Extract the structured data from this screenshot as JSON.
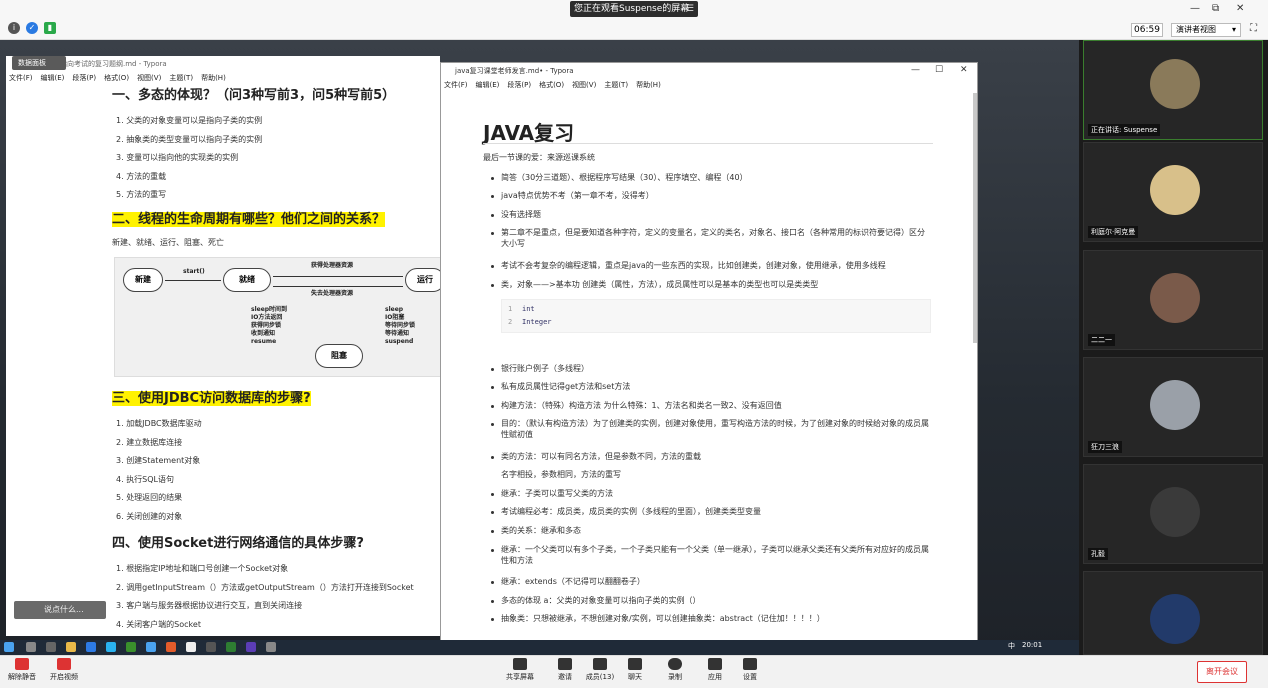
{
  "meeting": {
    "share_banner": "您正在观看Suspense的屏幕",
    "timer": "06:59",
    "view_mode": "演讲者视图"
  },
  "left_window": {
    "title": "指向考试的复习题纲.md - Typora",
    "vote_label": "数据面板",
    "menu": [
      "文件(F)",
      "编辑(E)",
      "段落(P)",
      "格式(O)",
      "视图(V)",
      "主题(T)",
      "帮助(H)"
    ],
    "h1": "一、多态的体现？（问3种写前3，问5种写前5）",
    "list1": [
      "父类的对象变量可以是指向子类的实例",
      "抽象类的类型变量可以指向子类的实例",
      "变量可以指向他的实现类的实例",
      "方法的重载",
      "方法的重写"
    ],
    "h2": "二、线程的生命周期有哪些？他们之间的关系？",
    "states": "新建、就绪、运行、阻塞、死亡",
    "diagram": {
      "new": "新建",
      "ready": "就绪",
      "run": "运行",
      "blocked": "阻塞",
      "start": "start()",
      "get_res": "获得处理器资源",
      "lose_res": "失去处理器资源",
      "left_notes": "sleep时间到\nIO方法返回\n获得同步锁\n收到通知\nresume",
      "right_notes": "sleep\nIO阻塞\n等待同步锁\n等待通知\nsuspend"
    },
    "h3": "三、使用JDBC访问数据库的步骤?",
    "list3": [
      "加载JDBC数据库驱动",
      "建立数据库连接",
      "创建Statement对象",
      "执行SQL语句",
      "处理返回的结果",
      "关闭创建的对象"
    ],
    "h4": "四、使用Socket进行网络通信的具体步骤?",
    "list4": [
      "根据指定IP地址和端口号创建一个Socket对象",
      "调用getInputStream（）方法或getOutputStream（）方法打开连接到Socket",
      "客户端与服务器根据协议进行交互，直到关闭连接",
      "关闭客户端的Socket"
    ],
    "chat_placeholder": "说点什么..."
  },
  "right_window": {
    "title": "java复习课堂老师发言.md• - Typora",
    "menu": [
      "文件(F)",
      "编辑(E)",
      "段落(P)",
      "格式(O)",
      "视图(V)",
      "主题(T)",
      "帮助(H)"
    ],
    "doc_title": "JAVA复习",
    "subtitle": "最后一节课的爱：来源巡课系统",
    "items1": [
      "简答（30分三道题）、根据程序写结果（30）、程序填空、编程（40）",
      "java特点优势不考（第一章不考，没得考）",
      "没有选择题",
      "第二章不是重点，但是要知道各种字符，定义的变量名，定义的类名，对象名、接口名（各种常用的标识符要记得）区分大小写",
      "考试不会考复杂的编程逻辑，重点是java的一些东西的实现，比如创建类，创建对象，使用继承，使用多线程",
      "类，对象——>基本功   创建类（属性，方法），成员属性可以是基本的类型也可以是类类型"
    ],
    "code": [
      "int",
      "Integer"
    ],
    "items2": [
      "银行账户例子（多线程）",
      "私有成员属性记得get方法和set方法",
      "构建方法：（特殊）构造方法 为什么特殊：1、方法名和类名一致2、没有返回值",
      "目的：（默认有构造方法）为了创建类的实例，创建对象使用，重写构造方法的时候，为了创建对象的时候给对象的成员属性赋初值",
      "类的方法：可以有同名方法，但是参数不同，方法的重载",
      "名字相投，参数相同，方法的重写",
      "继承：子类可以重写父类的方法",
      "考试编程必考：成员类，成员类的实例（多线程的里面），创建类类型变量",
      "类的关系：继承和多态",
      "继承：一个父类可以有多个子类，一个子类只能有一个父类（单一继承），子类可以继承父类还有父类所有对应好的成员属性和方法",
      "继承：extends（不记得可以翻翻卷子）",
      "多态的体现  a：父类的对象变量可以指向子类的实例（）",
      "抽象类：只想被继承，不想创建对象/实例，可以创建抽象类：abstract（记住加！！！！）"
    ]
  },
  "participants": [
    {
      "name": "正在讲话: Suspense"
    },
    {
      "name": "利庭尔·阿克曼"
    },
    {
      "name": "二二一"
    },
    {
      "name": "狂刀三浪"
    },
    {
      "name": "孔毅"
    },
    {
      "name": ""
    }
  ],
  "taskbar": {
    "lang": "中",
    "time": "20:01"
  },
  "toolbar": {
    "mute": "解除静音",
    "video": "开启视频",
    "share": "共享屏幕",
    "invite": "邀请",
    "members": "成员(13)",
    "chat": "聊天",
    "record": "录制",
    "apps": "应用",
    "settings": "设置",
    "leave": "离开会议"
  }
}
